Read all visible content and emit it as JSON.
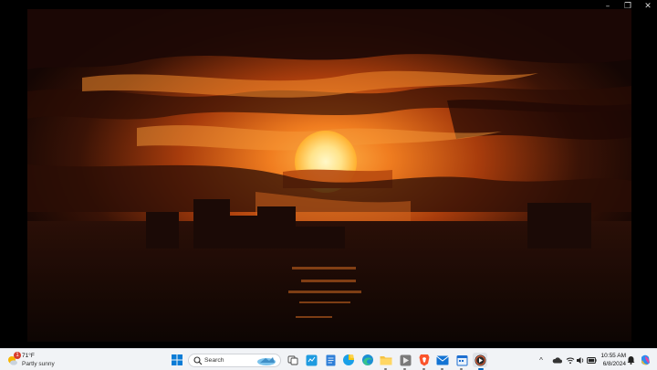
{
  "window": {
    "controls": {
      "minimize": "–",
      "maximize": "❐",
      "close": "✕"
    }
  },
  "video": {
    "content": "sunset-over-city-and-sea"
  },
  "taskbar": {
    "weather": {
      "temp": "71°F",
      "desc": "Partly sunny",
      "badge": "1",
      "icon": "weather-sun-icon"
    },
    "search": {
      "placeholder": "Search"
    },
    "apps": [
      {
        "name": "start",
        "icon": "windows-logo-icon"
      },
      {
        "name": "task-view",
        "icon": "task-view-icon"
      },
      {
        "name": "widgets",
        "icon": "widgets-icon"
      },
      {
        "name": "notepad",
        "icon": "notepad-icon"
      },
      {
        "name": "copilot",
        "icon": "copilot-icon"
      },
      {
        "name": "edge",
        "icon": "edge-icon"
      },
      {
        "name": "file-explorer",
        "icon": "folder-icon"
      },
      {
        "name": "app",
        "icon": "app-icon"
      },
      {
        "name": "brave",
        "icon": "brave-icon"
      },
      {
        "name": "mail",
        "icon": "mail-icon"
      },
      {
        "name": "calendar",
        "icon": "calendar-icon"
      },
      {
        "name": "media-player",
        "icon": "media-player-icon"
      }
    ],
    "tray": {
      "chevron": "^",
      "time": "10:55 AM",
      "date": "6/8/2024"
    }
  },
  "colors": {
    "taskbar_bg": "#f1f3f6",
    "accent": "#0067c0",
    "sun": "#fff3a0",
    "sky_orange": "#e8701c"
  }
}
